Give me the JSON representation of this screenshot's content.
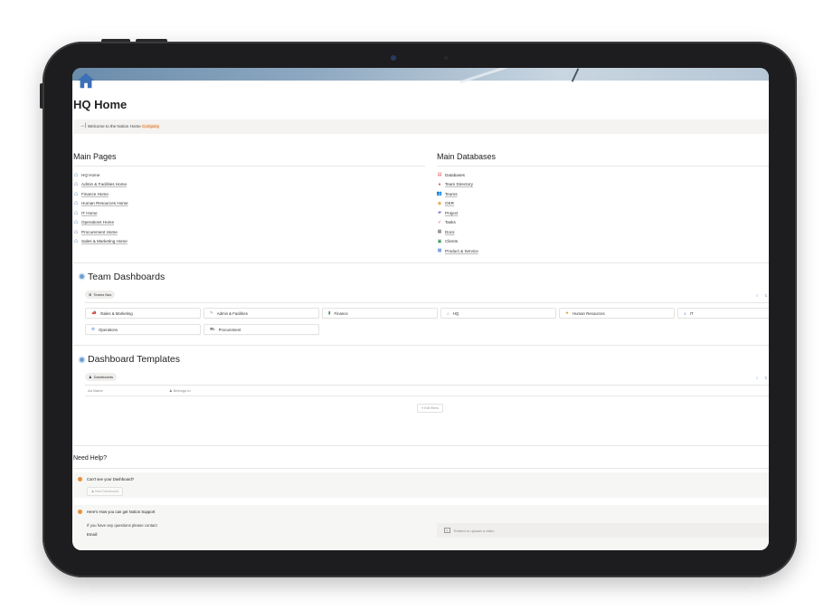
{
  "page": {
    "title": "HQ Home",
    "callout_text": "Welcome to the Notion Home ",
    "callout_highlight": "Company"
  },
  "main_pages": {
    "heading": "Main Pages",
    "items": [
      {
        "label": "HQ Home",
        "icon": "house-icon"
      },
      {
        "label": "Admin & Facilities Home",
        "icon": "house-icon"
      },
      {
        "label": "Finance Home",
        "icon": "house-icon"
      },
      {
        "label": "Human Resources Home",
        "icon": "house-icon"
      },
      {
        "label": "IT Home",
        "icon": "house-icon"
      },
      {
        "label": "Operations Home",
        "icon": "house-icon"
      },
      {
        "label": "Procurement Home",
        "icon": "house-icon"
      },
      {
        "label": "Sales & Marketing Home",
        "icon": "house-icon"
      }
    ]
  },
  "main_databases": {
    "heading": "Main Databases",
    "items": [
      {
        "label": "Databases",
        "icon": "database-icon",
        "color": "#d9534f"
      },
      {
        "label": "Team Directory",
        "icon": "people-icon",
        "color": "#e05a4a"
      },
      {
        "label": "Teams",
        "icon": "group-icon",
        "color": "#4f7fcf"
      },
      {
        "label": "OKR",
        "icon": "target-icon",
        "color": "#e4a13a"
      },
      {
        "label": "Project",
        "icon": "folder-icon",
        "color": "#7a6cc9"
      },
      {
        "label": "Tasks",
        "icon": "checklist-icon",
        "color": "#c0392b"
      },
      {
        "label": "Docs",
        "icon": "doc-icon",
        "color": "#5a5a5a"
      },
      {
        "label": "Clients",
        "icon": "client-icon",
        "color": "#3a8f5a"
      },
      {
        "label": "Product & Service",
        "icon": "box-icon",
        "color": "#4f7fcf"
      }
    ]
  },
  "team_dashboards": {
    "heading": "Team Dashboards",
    "view_label": "Teams Nav",
    "cards": [
      {
        "label": "/Sales & Marketing",
        "icon": "megaphone-icon"
      },
      {
        "label": "Admin & Facilities",
        "icon": "tools-icon"
      },
      {
        "label": "Finance",
        "icon": "money-icon"
      },
      {
        "label": "HQ",
        "icon": "house-icon"
      },
      {
        "label": "Human Resources",
        "icon": "star-icon"
      },
      {
        "label": "IT",
        "icon": "server-icon"
      },
      {
        "label": "Operations",
        "icon": "gear-icon"
      },
      {
        "label": "Procurement",
        "icon": "cart-icon"
      }
    ]
  },
  "dashboard_templates": {
    "heading": "Dashboard Templates",
    "view_label": "Dashboards",
    "col_name": "Name",
    "col_belongs": "Belongs to",
    "edit_filters": "Edit filters"
  },
  "help": {
    "heading": "Need Help?",
    "q1": "Can't see your Dashboard?",
    "new_dashboard": "New Dashboard",
    "q2": "Here's How you can get Notion Support",
    "contact_text": "If you have any questions please contact",
    "email_label": "Email:",
    "video_placeholder": "Embed or upload a video"
  },
  "colors": {
    "accent_blue": "#6e9fd1",
    "warning_orange": "#e6913a",
    "house_blue": "#3b6fb6"
  }
}
